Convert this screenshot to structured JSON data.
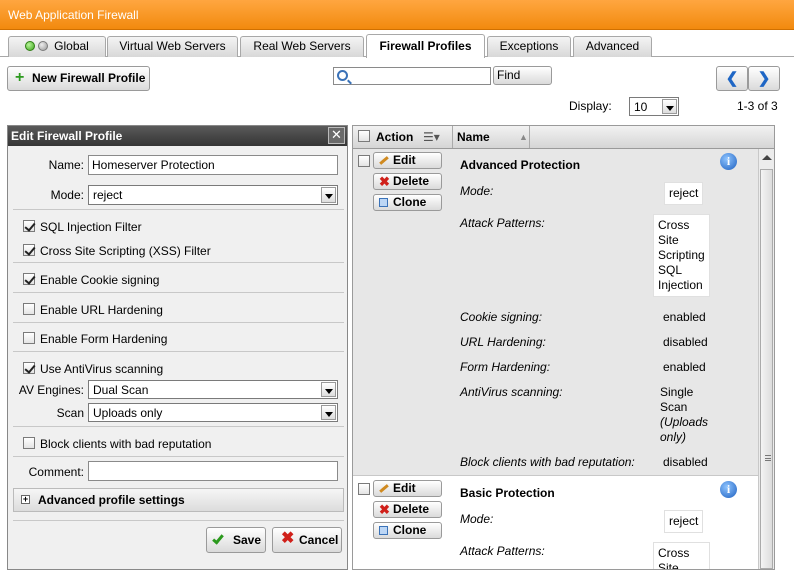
{
  "window": {
    "title": "Web Application Firewall"
  },
  "tabs": [
    {
      "label": "Global"
    },
    {
      "label": "Virtual Web Servers"
    },
    {
      "label": "Real Web Servers"
    },
    {
      "label": "Firewall Profiles"
    },
    {
      "label": "Exceptions"
    },
    {
      "label": "Advanced"
    }
  ],
  "toolbar": {
    "new_profile": "New Firewall Profile",
    "search_value": "",
    "find": "Find",
    "display_label": "Display:",
    "display_value": "10",
    "paging": "1-3 of 3"
  },
  "edit_panel": {
    "title": "Edit Firewall Profile",
    "name_label": "Name:",
    "name_value": "Homeserver Protection",
    "mode_label": "Mode:",
    "mode_value": "reject",
    "sql_injection": "SQL Injection Filter",
    "xss": "Cross Site Scripting (XSS) Filter",
    "cookie_signing": "Enable Cookie signing",
    "url_hardening": "Enable URL Hardening",
    "form_hardening": "Enable Form Hardening",
    "antivirus": "Use AntiVirus scanning",
    "av_engines_label": "AV Engines:",
    "av_engines_value": "Dual Scan",
    "scan_label": "Scan",
    "scan_value": "Uploads only",
    "bad_reputation": "Block clients with bad reputation",
    "comment_label": "Comment:",
    "comment_value": "",
    "advanced": "Advanced profile settings",
    "save": "Save",
    "cancel": "Cancel"
  },
  "list": {
    "col_action": "Action",
    "col_name": "Name",
    "btn_edit": "Edit",
    "btn_delete": "Delete",
    "btn_clone": "Clone",
    "profiles": [
      {
        "title": "Advanced Protection",
        "mode_key": "Mode:",
        "mode_val": "reject",
        "attack_key": "Attack Patterns:",
        "attack_1": "Cross",
        "attack_2": "Site",
        "attack_3": "Scripting",
        "attack_4": "SQL",
        "attack_5": "Injection",
        "cookie_key": "Cookie signing:",
        "cookie_val": "enabled",
        "url_key": "URL Hardening:",
        "url_val": "disabled",
        "form_key": "Form Hardening:",
        "form_val": "enabled",
        "av_key": "AntiVirus scanning:",
        "av_1": "Single",
        "av_2": "Scan",
        "av_3": "(Uploads",
        "av_4": "only)",
        "block_key": "Block clients with bad reputation:",
        "block_val": "disabled"
      },
      {
        "title": "Basic Protection",
        "mode_key": "Mode:",
        "mode_val": "reject",
        "attack_key": "Attack Patterns:",
        "attack_1": "Cross",
        "attack_2": "Site"
      }
    ]
  }
}
